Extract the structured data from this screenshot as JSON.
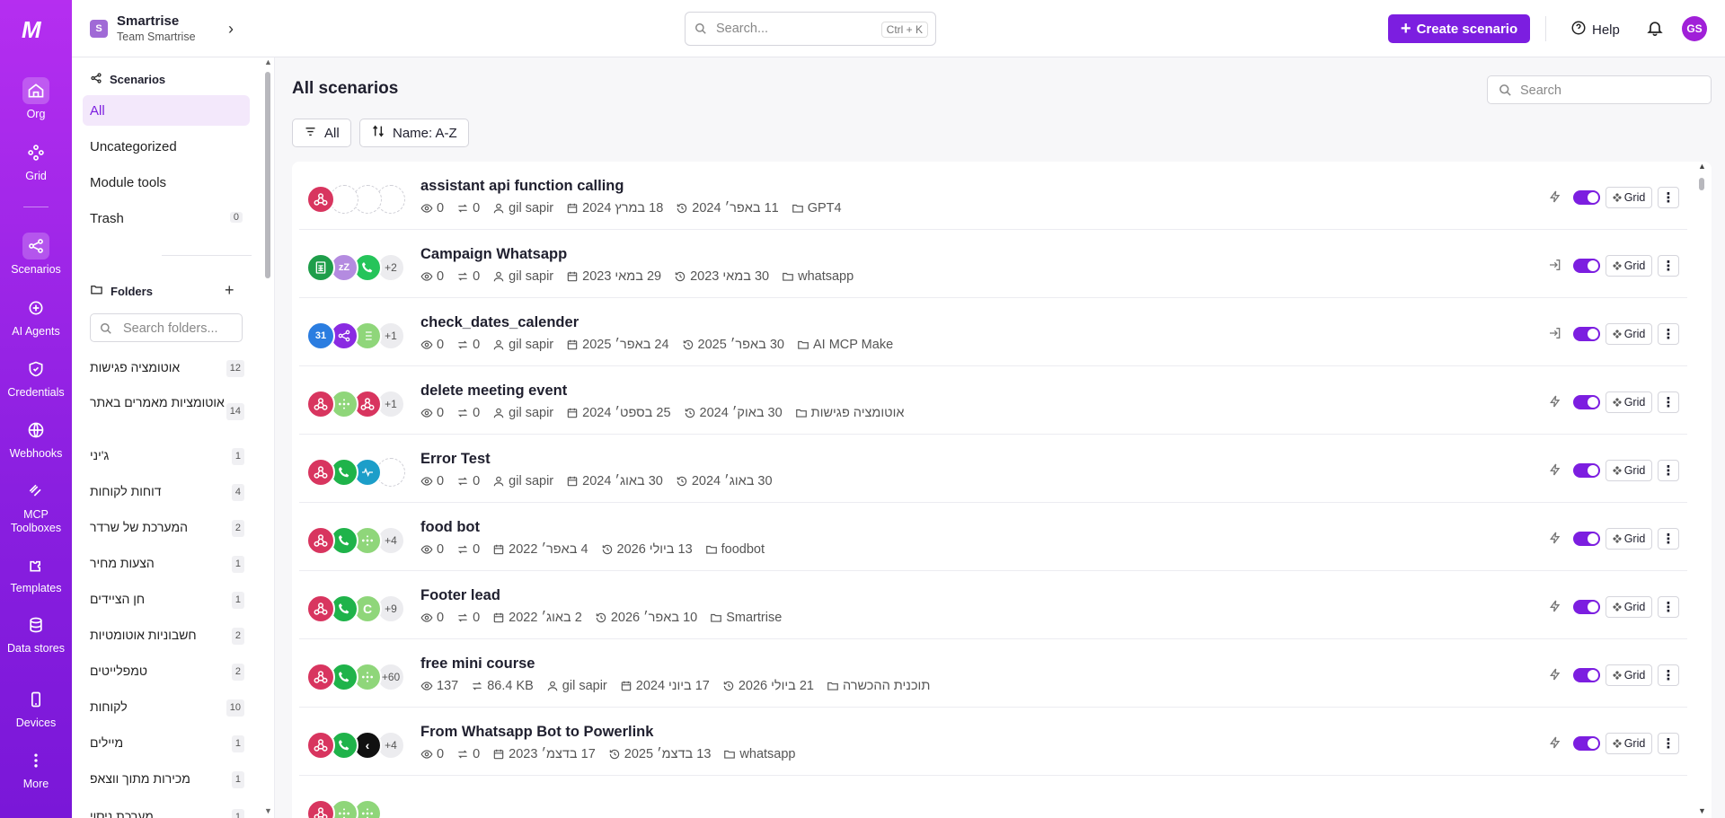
{
  "rail": {
    "logo": "M",
    "items": [
      {
        "label": "Org",
        "icon": "home-icon"
      },
      {
        "label": "Grid",
        "icon": "grid-icon"
      },
      {
        "label": "Scenarios",
        "icon": "share-icon"
      },
      {
        "label": "AI Agents",
        "icon": "ai-agent-icon"
      },
      {
        "label": "Credentials",
        "icon": "shield-icon"
      },
      {
        "label": "Webhooks",
        "icon": "globe-icon"
      },
      {
        "label": "MCP Toolboxes",
        "icon": "mcp-icon"
      },
      {
        "label": "Templates",
        "icon": "puzzle-icon"
      },
      {
        "label": "Data stores",
        "icon": "database-icon"
      },
      {
        "label": "Devices",
        "icon": "phone-icon"
      },
      {
        "label": "More",
        "icon": "more-vertical-icon"
      }
    ]
  },
  "topbar": {
    "org_badge": "S",
    "org_name": "Smartrise",
    "org_team": "Team Smartrise",
    "search_placeholder": "Search...",
    "search_shortcut": "Ctrl + K",
    "create_label": "Create scenario",
    "help_label": "Help",
    "avatar_initials": "GS"
  },
  "sidebar": {
    "scenarios_heading": "Scenarios",
    "nav": [
      {
        "label": "All",
        "count": ""
      },
      {
        "label": "Uncategorized",
        "count": ""
      },
      {
        "label": "Module tools",
        "count": ""
      },
      {
        "label": "Trash",
        "count": "0"
      }
    ],
    "folders_heading": "Folders",
    "folder_search_placeholder": "Search folders...",
    "folders": [
      {
        "name": "אוטומציה פגישות",
        "count": "12"
      },
      {
        "name": "אוטומציות מאמרים באתר",
        "count": "14"
      },
      {
        "name": "ג'יני",
        "count": "1"
      },
      {
        "name": "דוחות לקוחות",
        "count": "4"
      },
      {
        "name": "המערכת של שרדר",
        "count": "2"
      },
      {
        "name": "הצעות מחיר",
        "count": "1"
      },
      {
        "name": "חן הציידים",
        "count": "1"
      },
      {
        "name": "חשבוניות אוטומטיות",
        "count": "2"
      },
      {
        "name": "טמפלייטים",
        "count": "2"
      },
      {
        "name": "לקוחות",
        "count": "10"
      },
      {
        "name": "מיילים",
        "count": "1"
      },
      {
        "name": "מכירות מתוך ווצאפ",
        "count": "1"
      },
      {
        "name": "מערכת ניסוי",
        "count": "1"
      }
    ]
  },
  "main": {
    "title": "All scenarios",
    "search_placeholder": "Search",
    "filter_label": "All",
    "sort_label": "Name: A-Z",
    "grid_label": "Grid",
    "scenarios": [
      {
        "name": "assistant api function calling",
        "views": "0",
        "ops": "0",
        "owner": "gil sapir",
        "created": "18 במרץ 2024",
        "updated": "11 באפר׳ 2024",
        "folder": "GPT4",
        "trigger": "instant",
        "more": "",
        "icons": [
          {
            "c": "#d8355f",
            "g": "webhook"
          },
          {
            "c": "",
            "g": "empty"
          },
          {
            "c": "",
            "g": "empty"
          },
          {
            "c": "",
            "g": "empty"
          }
        ]
      },
      {
        "name": "Campaign Whatsapp",
        "views": "0",
        "ops": "0",
        "owner": "gil sapir",
        "created": "29 במאי 2023",
        "updated": "30 במאי 2023",
        "folder": "whatsapp",
        "trigger": "on-demand",
        "more": "+2",
        "icons": [
          {
            "c": "#1e9e4a",
            "g": "sheets"
          },
          {
            "c": "#b48be0",
            "g": "zzz"
          },
          {
            "c": "#25c45a",
            "g": "phone"
          }
        ]
      },
      {
        "name": "check_dates_calender",
        "views": "0",
        "ops": "0",
        "owner": "gil sapir",
        "created": "24 באפר׳ 2025",
        "updated": "30 באפר׳ 2025",
        "folder": "AI MCP Make",
        "trigger": "on-demand",
        "more": "+1",
        "icons": [
          {
            "c": "#2b7de0",
            "g": "31"
          },
          {
            "c": "#8a2be2",
            "g": "share"
          },
          {
            "c": "#8fd67a",
            "g": "list"
          }
        ]
      },
      {
        "name": "delete meeting event",
        "views": "0",
        "ops": "0",
        "owner": "gil sapir",
        "created": "25 בספט׳ 2024",
        "updated": "30 באוק׳ 2024",
        "folder": "אוטומציה פגישות",
        "trigger": "instant",
        "more": "+1",
        "icons": [
          {
            "c": "#d8355f",
            "g": "webhook"
          },
          {
            "c": "#8fd67a",
            "g": "dots"
          },
          {
            "c": "#d8355f",
            "g": "webhook"
          }
        ]
      },
      {
        "name": "Error Test",
        "views": "0",
        "ops": "0",
        "owner": "gil sapir",
        "created": "30 באוג׳ 2024",
        "updated": "30 באוג׳ 2024",
        "folder": "",
        "trigger": "instant",
        "more": "",
        "icons": [
          {
            "c": "#d8355f",
            "g": "webhook"
          },
          {
            "c": "#1fb34a",
            "g": "phone"
          },
          {
            "c": "#1c9ec9",
            "g": "pulse"
          },
          {
            "c": "",
            "g": "empty"
          }
        ]
      },
      {
        "name": "food bot",
        "views": "0",
        "ops": "0",
        "owner": "",
        "created": "4 באפר׳ 2022",
        "updated": "13 ביולי 2026",
        "folder": "foodbot",
        "trigger": "instant",
        "more": "+4",
        "icons": [
          {
            "c": "#d8355f",
            "g": "webhook"
          },
          {
            "c": "#1fb34a",
            "g": "phone"
          },
          {
            "c": "#8fd67a",
            "g": "dots"
          }
        ]
      },
      {
        "name": "Footer lead",
        "views": "0",
        "ops": "0",
        "owner": "",
        "created": "2 באוג׳ 2022",
        "updated": "10 באפר׳ 2026",
        "folder": "Smartrise",
        "trigger": "instant",
        "more": "+9",
        "icons": [
          {
            "c": "#d8355f",
            "g": "webhook"
          },
          {
            "c": "#1fb34a",
            "g": "phone"
          },
          {
            "c": "#8fd67a",
            "g": "c"
          }
        ]
      },
      {
        "name": "free mini course",
        "views": "137",
        "ops": "86.4 KB",
        "owner": "gil sapir",
        "created": "17 ביוני 2024",
        "updated": "21 ביולי 2026",
        "folder": "תוכנית ההכשרה",
        "trigger": "instant",
        "more": "+60",
        "icons": [
          {
            "c": "#d8355f",
            "g": "webhook"
          },
          {
            "c": "#1fb34a",
            "g": "phone"
          },
          {
            "c": "#8fd67a",
            "g": "dots"
          }
        ]
      },
      {
        "name": "From Whatsapp Bot to Powerlink",
        "views": "0",
        "ops": "0",
        "owner": "",
        "created": "17 בדצמ׳ 2023",
        "updated": "13 בדצמ׳ 2025",
        "folder": "whatsapp",
        "trigger": "instant",
        "more": "+4",
        "icons": [
          {
            "c": "#d8355f",
            "g": "webhook"
          },
          {
            "c": "#1fb34a",
            "g": "phone"
          },
          {
            "c": "#111111",
            "g": "chevron"
          }
        ]
      },
      {
        "name": "",
        "views": "",
        "ops": "",
        "owner": "",
        "created": "",
        "updated": "",
        "folder": "",
        "trigger": "instant",
        "more": "",
        "icons": [
          {
            "c": "#d8355f",
            "g": "webhook"
          },
          {
            "c": "#8fd67a",
            "g": "dots"
          },
          {
            "c": "#8fd67a",
            "g": "dots"
          }
        ]
      }
    ]
  }
}
